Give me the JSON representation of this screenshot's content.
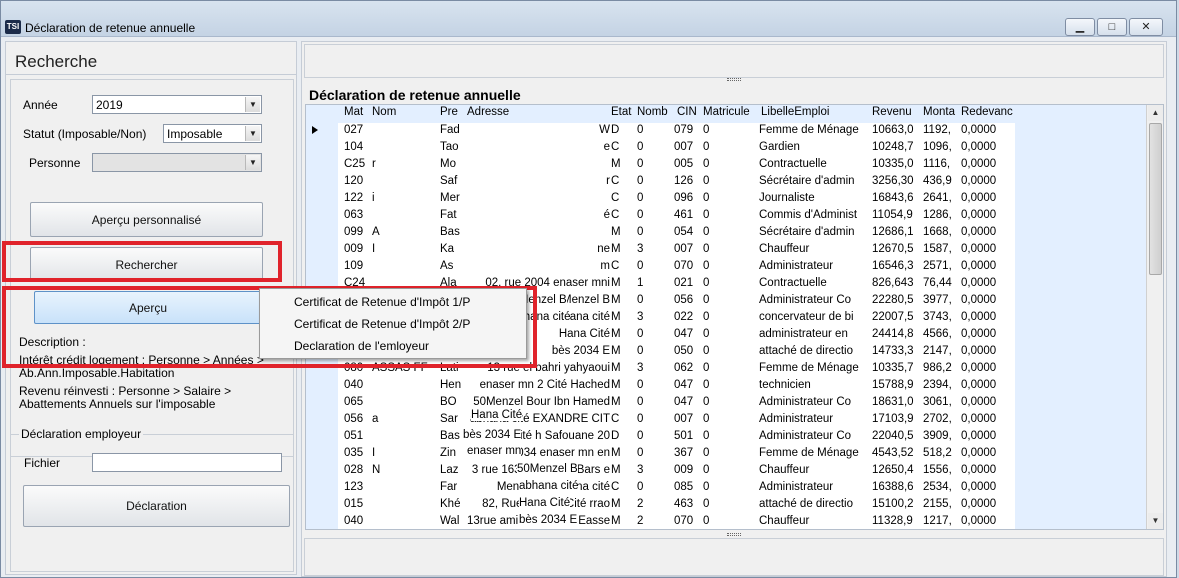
{
  "window": {
    "title": "Déclaration de retenue annuelle",
    "icon_text": "TSI",
    "min_glyph": "▁",
    "max_glyph": "□",
    "close_glyph": "✕"
  },
  "left": {
    "header": "Recherche",
    "annee_label": "Année",
    "annee_value": "2019",
    "statut_label": "Statut (Imposable/Non)",
    "statut_value": "Imposable",
    "personne_label": "Personne",
    "personne_value": "",
    "apercu_perso_label": "Aperçu personnalisé",
    "rechercher_label": "Rechercher",
    "apercu_label": "Aperçu",
    "description_label": "Description :",
    "description_lines": [
      "Intérêt crédit logement : Personne > Années >",
      "Ab.Ann.Imposable.Habitation",
      "Revenu réinvesti : Personne > Salaire  >",
      "Abattements Annuels sur l'imposable"
    ],
    "declaration_employeur_label": "Déclaration employeur",
    "fichier_label": "Fichier",
    "fichier_value": "",
    "declaration_button": "Déclaration"
  },
  "context_menu": {
    "items": [
      "Certificat de Retenue d'Impôt 1/P",
      "Certificat de Retenue d'Impôt 2/P",
      "Declaration de l'emloyeur"
    ]
  },
  "grid": {
    "title": "Déclaration de retenue annuelle",
    "columns": [
      "Mat",
      "Nom",
      "Pre",
      "Adresse",
      "Etat",
      "Nomb",
      "CIN",
      "Matricule",
      "LibelleEmploi",
      "Revenu",
      "Monta",
      "Redevanc"
    ],
    "rows": [
      [
        "027",
        "",
        "Fad",
        "W",
        "D",
        "0",
        "079",
        "0",
        "Femme de Ménage",
        "10663,0",
        "1192,",
        "0,0000"
      ],
      [
        "104",
        "",
        "Tao",
        "e",
        "C",
        "0",
        "007",
        "0",
        "Gardien",
        "10248,7",
        "1096,",
        "0,0000"
      ],
      [
        "C25",
        "r",
        "Mo",
        "",
        "M",
        "0",
        "005",
        "0",
        "Contractuelle",
        "10335,0",
        "1116,",
        "0,0000"
      ],
      [
        "120",
        "",
        "Saf",
        "r",
        "C",
        "0",
        "126",
        "0",
        "Sécrétaire d'admin",
        "3256,30",
        "436,9",
        "0,0000"
      ],
      [
        "122",
        "i",
        "Mer",
        "",
        "C",
        "0",
        "096",
        "0",
        "Journaliste",
        "16843,6",
        "2641,",
        "0,0000"
      ],
      [
        "063",
        "",
        "Fat",
        "é",
        "C",
        "0",
        "461",
        "0",
        "Commis d'Administ",
        "11054,9",
        "1286,",
        "0,0000"
      ],
      [
        "099",
        "A",
        "Bas",
        "",
        "M",
        "0",
        "054",
        "0",
        "Sécrétaire d'admin",
        "12686,1",
        "1668,",
        "0,0000"
      ],
      [
        "009",
        "I",
        "Ka",
        "ne",
        "M",
        "3",
        "007",
        "0",
        "Chauffeur",
        "12670,5",
        "1587,",
        "0,0000"
      ],
      [
        "109",
        "",
        "As",
        "m",
        "C",
        "0",
        "070",
        "0",
        "Administrateur",
        "16546,3",
        "2571,",
        "0,0000"
      ],
      [
        "C24",
        "",
        "Ala",
        "02, rue 2004 enaser mni",
        "M",
        "1",
        "021",
        "0",
        "Contractuelle",
        "826,643",
        "76,44",
        "0,0000"
      ],
      [
        "",
        "",
        "",
        "050Menzel B",
        "M",
        "0",
        "056",
        "0",
        "Administrateur Co",
        "22280,5",
        "3977,",
        "0,0000"
      ],
      [
        "",
        "",
        "",
        "abhana cité",
        "M",
        "3",
        "022",
        "0",
        "concervateur de bi",
        "22007,5",
        "3743,",
        "0,0000"
      ],
      [
        "",
        "",
        "",
        "Hana Cité",
        "M",
        "0",
        "047",
        "0",
        "administrateur en",
        "24414,8",
        "4566,",
        "0,0000"
      ],
      [
        "",
        "",
        "",
        "bès 2034 E",
        "M",
        "0",
        "050",
        "0",
        "attaché de directio",
        "14733,3",
        "2147,",
        "0,0000"
      ],
      [
        "080",
        "ASSAS FF",
        "Lati",
        "13 rue el bahri yahyaoui",
        "M",
        "3",
        "062",
        "0",
        "Femme de Ménage",
        "10335,7",
        "986,2",
        "0,0000"
      ],
      [
        "040",
        "",
        "Hen",
        "enaser mn 2 Cité Hached",
        "M",
        "0",
        "047",
        "0",
        "technicien",
        "15788,9",
        "2394,",
        "0,0000"
      ],
      [
        "065",
        "",
        "BO",
        "50Menzel Bour Ibn Hamed",
        "M",
        "0",
        "047",
        "0",
        "Administrateur Co",
        "18631,0",
        "3061,",
        "0,0000"
      ],
      [
        "056",
        "a",
        "Sar",
        "abhana cité EXANDRE CIT",
        "C",
        "0",
        "007",
        "0",
        "Administrateur",
        "17103,9",
        "2702,",
        "0,0000"
      ],
      [
        "051",
        "",
        "Bas",
        "Hana Cité h Safouane 20",
        "D",
        "0",
        "501",
        "0",
        "Administrateur Co",
        "22040,5",
        "3909,",
        "0,0000"
      ],
      [
        "035",
        "I",
        "Zin",
        "abès 2034 enaser mn en",
        "M",
        "0",
        "367",
        "0",
        "Femme de Ménage",
        "4543,52",
        "518,2",
        "0,0000"
      ],
      [
        "028",
        "N",
        "Laz",
        "3 rue 163 50Menzel Bars e",
        "M",
        "3",
        "009",
        "0",
        "Chauffeur",
        "12650,4",
        "1556,",
        "0,0000"
      ],
      [
        "123",
        "",
        "Far",
        "Menzah 1 abhana cité",
        "C",
        "0",
        "085",
        "0",
        "Administrateur",
        "16388,6",
        "2534,",
        "0,0000"
      ],
      [
        "015",
        "",
        "Khé",
        "82, Rue 4 Hana Cité rrao",
        "M",
        "2",
        "463",
        "0",
        "attaché de directio",
        "15100,2",
        "2155,",
        "0,0000"
      ],
      [
        "040",
        "",
        "Wal",
        "13rue ami abès 2034 Easser",
        "M",
        "2",
        "070",
        "0",
        "Chauffeur",
        "11328,9",
        "1217,",
        "0,0000"
      ]
    ]
  },
  "stray_texts": [
    "50Menzel B",
    "abhana cité",
    "Hana Cité",
    "bès 2034 E",
    "enaser mn",
    "50Menzel B",
    "abhana cité",
    "Hana Cité",
    "bès 2034 E"
  ],
  "colors": {
    "highlight_red": "#e0232b",
    "grid_bg": "#e3efff",
    "window_bg": "#e9edf2"
  }
}
